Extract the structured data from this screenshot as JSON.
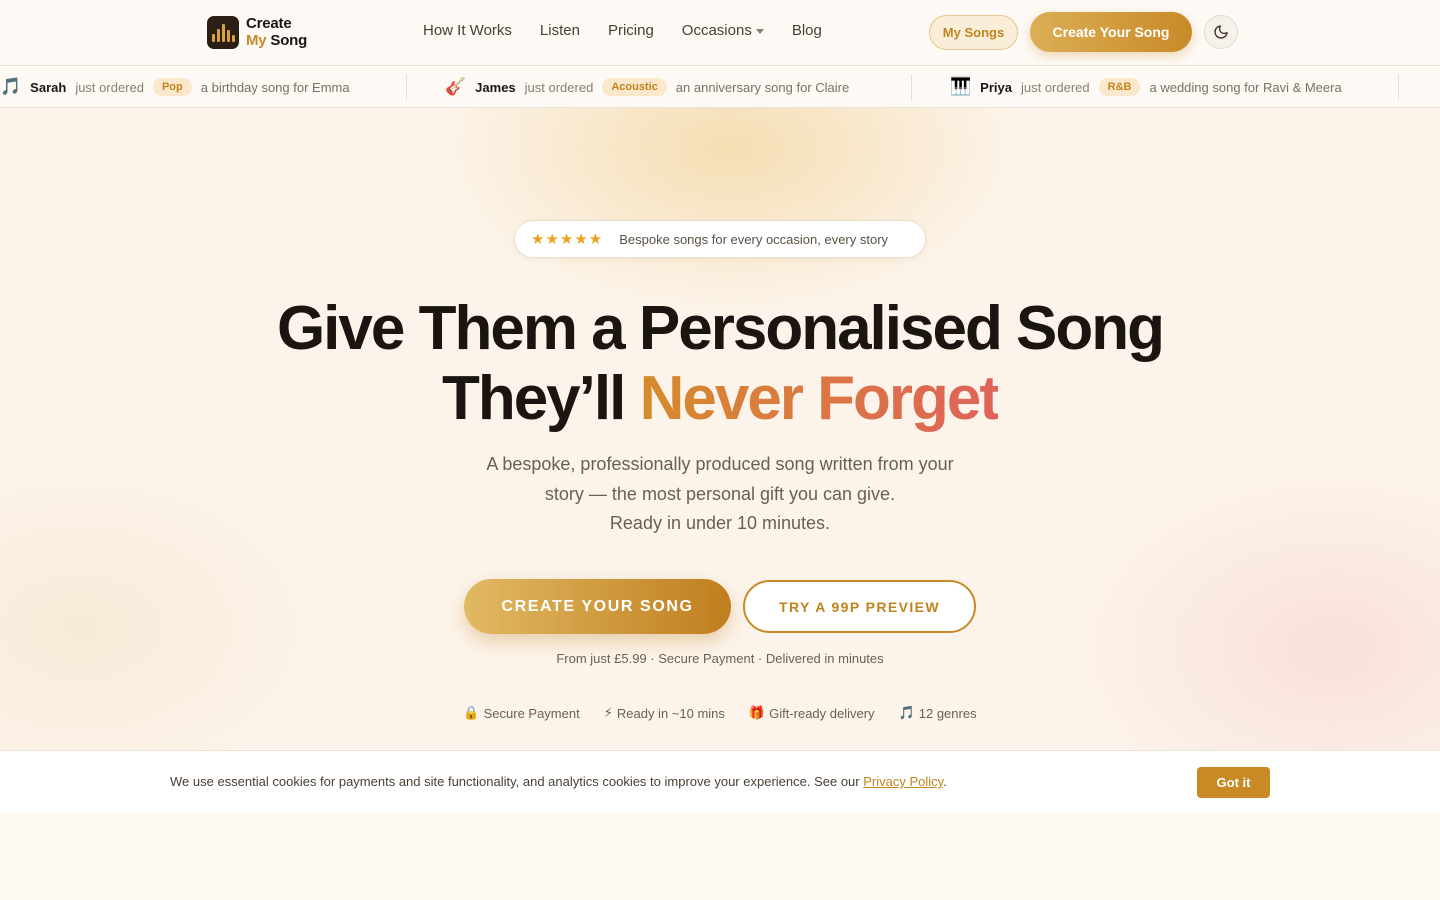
{
  "header": {
    "logo": {
      "line1": "Create",
      "line2_accent": "My",
      "line2_rest": "Song"
    },
    "nav": [
      {
        "label": "How It Works"
      },
      {
        "label": "Listen"
      },
      {
        "label": "Pricing"
      },
      {
        "label": "Occasions"
      },
      {
        "label": "Blog"
      }
    ],
    "my_songs": "My Songs",
    "create_song": "Create Your Song",
    "theme_icon": "moon-icon"
  },
  "ticker": [
    {
      "icon": "🎵",
      "name": "Sarah",
      "verb": "just ordered",
      "genre": "Pop",
      "desc": "a birthday song for Emma"
    },
    {
      "icon": "🎸",
      "name": "James",
      "verb": "just ordered",
      "genre": "Acoustic",
      "desc": "an anniversary song for Claire"
    },
    {
      "icon": "🎹",
      "name": "Priya",
      "verb": "just ordered",
      "genre": "R&B",
      "desc": "a wedding song for Ravi & Meera"
    }
  ],
  "hero": {
    "badge_stars": "★★★★★",
    "badge_text": "Bespoke songs for every occasion, every story",
    "title_line1": "Give Them a Personalised Song",
    "title_line2_plain": "They’ll",
    "title_line2_accent": "Never Forget",
    "subtitle_line1": "A bespoke, professionally produced song written from your",
    "subtitle_line2": "story — the most personal gift you can give.",
    "subtitle_line3": "Ready in under 10 minutes.",
    "cta_primary": "CREATE YOUR SONG",
    "cta_secondary": "TRY A 99P PREVIEW",
    "fine_print": "From just £5.99 · Secure Payment · Delivered in minutes",
    "trust": [
      {
        "icon": "🔒",
        "label": "Secure Payment"
      },
      {
        "icon": "⚡",
        "label": "Ready in ~10 mins"
      },
      {
        "icon": "🎁",
        "label": "Gift-ready delivery"
      },
      {
        "icon": "🎵",
        "label": "12 genres"
      }
    ]
  },
  "cookie": {
    "text": "We use essential cookies for payments and site functionality, and analytics cookies to improve your experience. See our",
    "link": "Privacy Policy",
    "suffix": ".",
    "button": "Got it"
  },
  "colors": {
    "accent": "#c98a26",
    "accent_light": "#dcae55",
    "gradient_end": "#e0625a",
    "text_dark": "#1c1712"
  }
}
